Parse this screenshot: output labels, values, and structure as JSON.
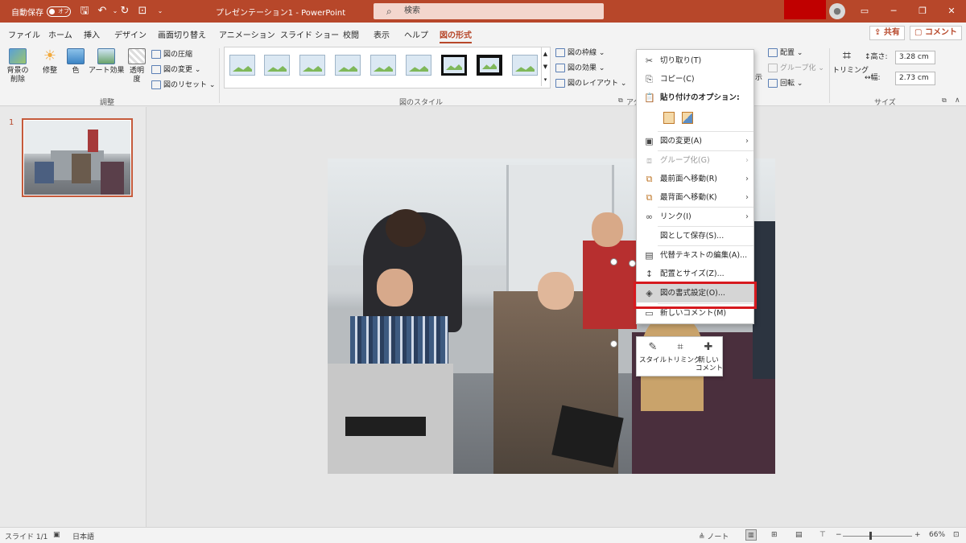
{
  "titlebar": {
    "autosave_label": "自動保存",
    "autosave_state": "オフ",
    "doc_title": "プレゼンテーション1  -  PowerPoint",
    "search_placeholder": "検索",
    "accent_color": "#b7472a"
  },
  "tabs": {
    "items": [
      "ファイル",
      "ホーム",
      "挿入",
      "デザイン",
      "画面切り替え",
      "アニメーション",
      "スライド ショー",
      "校閲",
      "表示",
      "ヘルプ",
      "図の形式"
    ],
    "active": "図の形式",
    "share_label": "共有",
    "comment_label": "コメント"
  },
  "ribbon": {
    "adjust": {
      "remove_bg": "背景の\n削除",
      "corrections": "修整",
      "color": "色",
      "artistic": "アート効果",
      "transparency": "透明\n度",
      "compress": "図の圧縮",
      "change": "図の変更",
      "reset": "図のリセット",
      "group_label": "調整"
    },
    "styles": {
      "border": "図の枠線",
      "effects": "図の効果",
      "layout": "図のレイアウト",
      "group_label": "図のスタイル",
      "partial_label": "アク"
    },
    "arrange": {
      "align": "配置",
      "group": "グループ化",
      "rotate": "回転",
      "partial_label": "示"
    },
    "size": {
      "crop": "トリミング",
      "height_label": "高さ:",
      "height_value": "3.28 cm",
      "width_label": "幅:",
      "width_value": "2.73 cm",
      "group_label": "サイズ"
    }
  },
  "slides_pane": {
    "slide_number": "1"
  },
  "context_menu": {
    "items": [
      {
        "label": "切り取り(T)",
        "icon": "cut-icon"
      },
      {
        "label": "コピー(C)",
        "icon": "copy-icon"
      },
      {
        "label": "貼り付けのオプション:",
        "icon": "paste-icon"
      },
      {
        "label": "図の変更(A)",
        "icon": "change-picture-icon"
      },
      {
        "label": "グループ化(G)",
        "icon": "group-icon"
      },
      {
        "label": "最前面へ移動(R)",
        "icon": "bring-front-icon"
      },
      {
        "label": "最背面へ移動(K)",
        "icon": "send-back-icon"
      },
      {
        "label": "リンク(I)",
        "icon": "link-icon"
      },
      {
        "label": "図として保存(S)...",
        "icon": ""
      },
      {
        "label": "代替テキストの編集(A)...",
        "icon": "alt-text-icon"
      },
      {
        "label": "配置とサイズ(Z)...",
        "icon": "size-position-icon"
      },
      {
        "label": "図の書式設定(O)...",
        "icon": "format-picture-icon"
      },
      {
        "label": "新しいコメント(M)",
        "icon": "comment-icon"
      }
    ],
    "highlighted": "図の書式設定(O)..."
  },
  "mini_toolbar": {
    "style": "スタイル",
    "crop": "トリミング",
    "new_comment": "新しい\nコメント"
  },
  "statusbar": {
    "slide": "スライド 1/1",
    "language": "日本語",
    "notes": "ノート",
    "zoom": "66%"
  }
}
